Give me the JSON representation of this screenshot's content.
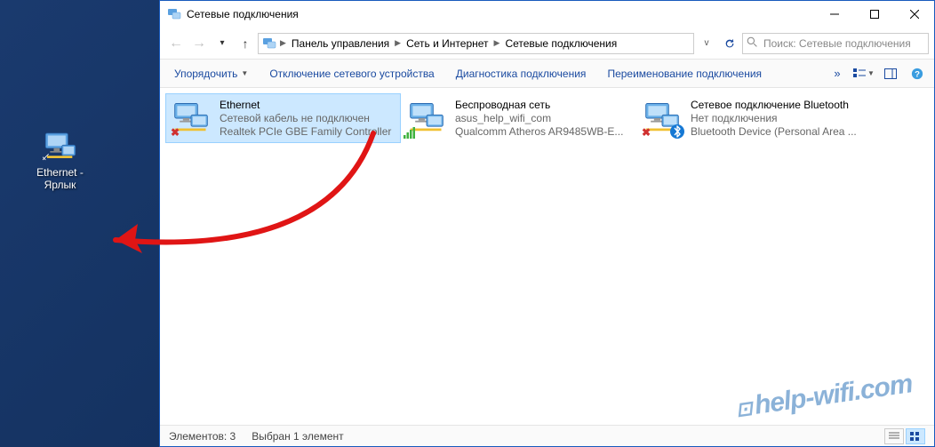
{
  "desktop": {
    "shortcut_label": "Ethernet - Ярлык"
  },
  "window": {
    "title": "Сетевые подключения"
  },
  "breadcrumbs": {
    "items": [
      "Панель управления",
      "Сеть и Интернет",
      "Сетевые подключения"
    ]
  },
  "search": {
    "placeholder": "Поиск: Сетевые подключения"
  },
  "commands": {
    "organize": "Упорядочить",
    "disable": "Отключение сетевого устройства",
    "diagnose": "Диагностика подключения",
    "rename": "Переименование подключения"
  },
  "connections": [
    {
      "name": "Ethernet",
      "status": "Сетевой кабель не подключен",
      "device": "Realtek PCIe GBE Family Controller",
      "badge": "error",
      "selected": true
    },
    {
      "name": "Беспроводная сеть",
      "status": "asus_help_wifi_com",
      "device": "Qualcomm Atheros AR9485WB-E...",
      "badge": "wifi",
      "selected": false
    },
    {
      "name": "Сетевое подключение Bluetooth",
      "status": "Нет подключения",
      "device": "Bluetooth Device (Personal Area ...",
      "badge": "error",
      "badge2": "bluetooth",
      "selected": false
    }
  ],
  "status_bar": {
    "count_label": "Элементов: 3",
    "selected_label": "Выбран 1 элемент"
  },
  "watermark": "help-wifi.com"
}
